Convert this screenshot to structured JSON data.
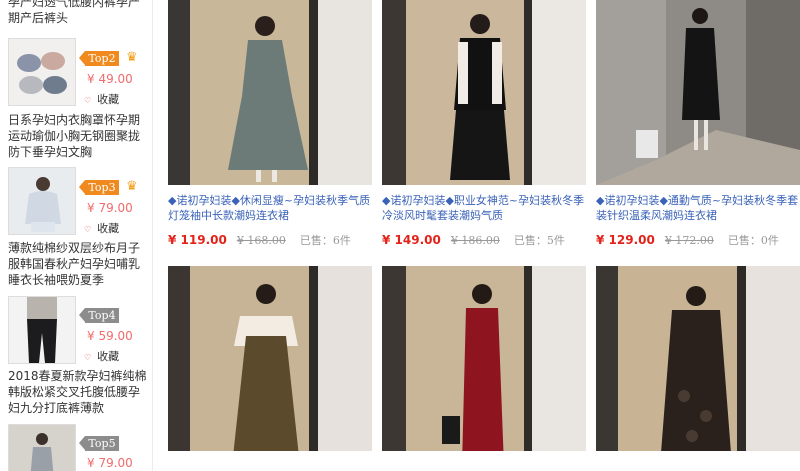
{
  "sidebar": {
    "items": [
      {
        "title": "孕产妇透气低腰内裤孕产期产后裤头",
        "rank": "",
        "price": "",
        "fav": ""
      },
      {
        "title": "日系孕妇内衣胸罩怀孕期运动瑜伽小胸无钢圈聚拢防下垂孕妇文胸",
        "rank": "Top2",
        "price": "¥ 49.00",
        "fav": "收藏"
      },
      {
        "title": "薄款纯棉纱双层纱布月子服韩国春秋产妇孕妇哺乳睡衣长袖喂奶夏季",
        "rank": "Top3",
        "price": "¥ 79.00",
        "fav": "收藏"
      },
      {
        "title": "2018春夏新款孕妇裤纯棉韩版松紧交叉托腹低腰孕妇九分打底裤薄款",
        "rank": "Top4",
        "price": "¥ 59.00",
        "fav": "收藏"
      },
      {
        "title": "",
        "rank": "Top5",
        "price": "¥ 79.00",
        "fav": ""
      }
    ]
  },
  "products": [
    {
      "title": "◆诺初孕妇装◆休闲显瘦~孕妇装秋季气质灯笼袖中长款潮妈连衣裙",
      "price": "¥ 119.00",
      "old": "¥ 168.00",
      "sold": "已售：6件"
    },
    {
      "title": "◆诺初孕妇装◆职业女神范~孕妇装秋冬季冷淡风时髦套装潮妈气质",
      "price": "¥ 149.00",
      "old": "¥ 186.00",
      "sold": "已售：5件"
    },
    {
      "title": "◆诺初孕妇装◆通勤气质~孕妇装秋冬季套装针织温柔风潮妈连衣裙",
      "price": "¥ 129.00",
      "old": "¥ 172.00",
      "sold": "已售：0件"
    },
    {
      "title": "",
      "price": "",
      "old": "",
      "sold": ""
    },
    {
      "title": "",
      "price": "",
      "old": "",
      "sold": ""
    },
    {
      "title": "",
      "price": "",
      "old": "",
      "sold": ""
    }
  ],
  "colors": {
    "link": "#3a62b8",
    "price": "#e2231a",
    "rank_hot": "#f08a1e",
    "rank_norm": "#8c8c8c"
  }
}
